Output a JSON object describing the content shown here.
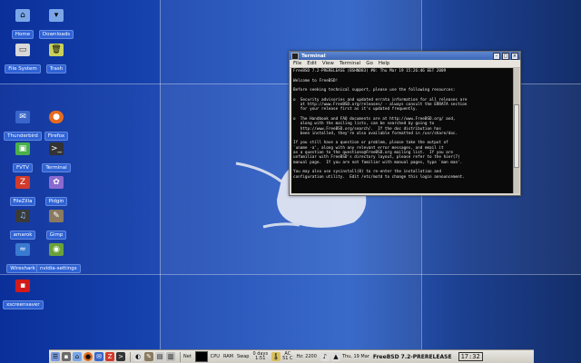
{
  "desktop_icons": [
    {
      "label": "Home",
      "icon": "home-folder-icon",
      "color": "#7aa6e8"
    },
    {
      "label": "Downloads",
      "icon": "downloads-folder-icon",
      "color": "#7aa6e8"
    },
    {
      "label": "File System",
      "icon": "file-system-icon",
      "color": "#d8d8d8"
    },
    {
      "label": "Trash",
      "icon": "trash-icon",
      "color": "#c8d05a"
    },
    {
      "label": "Thunderbird",
      "icon": "thunderbird-icon",
      "color": "#3a66c9"
    },
    {
      "label": "Firefox",
      "icon": "firefox-icon",
      "color": "#e66b1e"
    },
    {
      "label": "FVTV",
      "icon": "fvtv-icon",
      "color": "#4ab04a"
    },
    {
      "label": "Terminal",
      "icon": "terminal-icon",
      "color": "#333333"
    },
    {
      "label": "FileZilla",
      "icon": "filezilla-icon",
      "color": "#d23a2a"
    },
    {
      "label": "Pidgin",
      "icon": "pidgin-icon",
      "color": "#8a6ad0"
    },
    {
      "label": "amarok",
      "icon": "amarok-icon",
      "color": "#3a3a3a"
    },
    {
      "label": "Gimp",
      "icon": "gimp-icon",
      "color": "#8a7a60"
    },
    {
      "label": "Wireshark",
      "icon": "wireshark-icon",
      "color": "#3a7ad0"
    },
    {
      "label": "nvidia-settings",
      "icon": "nvidia-settings-icon",
      "color": "#6aa23a"
    },
    {
      "label": "xscreensaver",
      "icon": "xscreensaver-icon",
      "color": "#d21a1a"
    }
  ],
  "terminal": {
    "title": "Terminal",
    "menu": [
      "File",
      "Edit",
      "View",
      "Terminal",
      "Go",
      "Help"
    ],
    "lines": [
      "FreeBSD 7.2-PRERELEASE (BSHND83) #0: Thu Mar 19 15:26:46 EET 2009",
      "",
      "Welcome to FreeBSD!",
      "",
      "Before seeking technical support, please use the following resources:",
      "",
      "o  Security advisories and updated errata information for all releases are",
      "   at http://www.FreeBSD.org/releases/ - always consult the ERRATA section",
      "   for your release first as it's updated frequently.",
      "",
      "o  The Handbook and FAQ documents are at http://www.FreeBSD.org/ and,",
      "   along with the mailing lists, can be searched by going to",
      "   http://www.FreeBSD.org/search/.  If the doc distribution has",
      "   been installed, they're also available formatted in /usr/share/doc.",
      "",
      "If you still have a question or problem, please take the output of",
      "`uname -a', along with any relevant error messages, and email it",
      "as a question to the questions@FreeBSD.org mailing list.  If you are",
      "unfamiliar with FreeBSD's directory layout, please refer to the hier(7)",
      "manual page.  If you are not familiar with manual pages, type `man man'.",
      "",
      "You may also use sysinstall(8) to re-enter the installation and",
      "configuration utility.  Edit /etc/motd to change this login announcement."
    ]
  },
  "taskbar": {
    "net_label": "Net",
    "cpu_label": "CPU",
    "ram_label": "RAM",
    "swap_label": "Swap",
    "uptime_line1": "0 days",
    "uptime_line2": "1:51",
    "temp_line1": "AC",
    "temp_line2": "51 C",
    "freq": "Hz: 2200",
    "date": "Thu, 19 Mar",
    "os_name": "FreeBSD 7.2-PRERELEASE",
    "time": "17:32"
  }
}
